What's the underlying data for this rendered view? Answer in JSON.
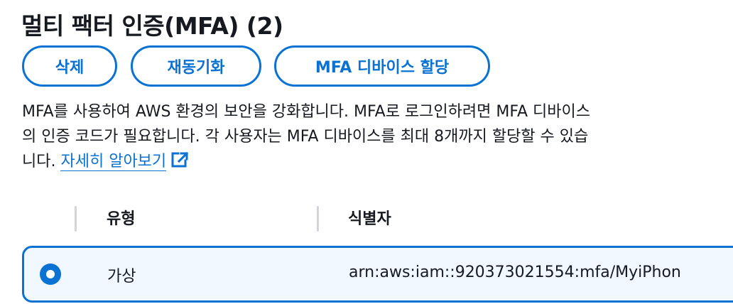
{
  "section": {
    "title": "멀티 팩터 인증(MFA) (2)"
  },
  "actions": {
    "delete_label": "삭제",
    "resync_label": "재동기화",
    "assign_label": "MFA 디바이스 할당"
  },
  "description": {
    "line1": "MFA를 사용하여 AWS 환경의 보안을 강화합니다. MFA로 로그인하려면 MFA 디바이스",
    "line2": "의 인증 코드가 필요합니다. 각 사용자는 MFA 디바이스를 최대 8개까지 할당할 수 있습",
    "line3": "니다.",
    "learn_more": "자세히 알아보기",
    "learn_more_icon": "external-link-icon"
  },
  "table": {
    "columns": [
      "유형",
      "식별자"
    ],
    "rows": [
      {
        "selected": true,
        "type": "가상",
        "identifier": "arn:aws:iam::920373021554:mfa/MyiPhon"
      }
    ]
  },
  "colors": {
    "accent": "#0972d3",
    "selected_row_bg": "#f1f8ff",
    "text": "#16191f"
  }
}
